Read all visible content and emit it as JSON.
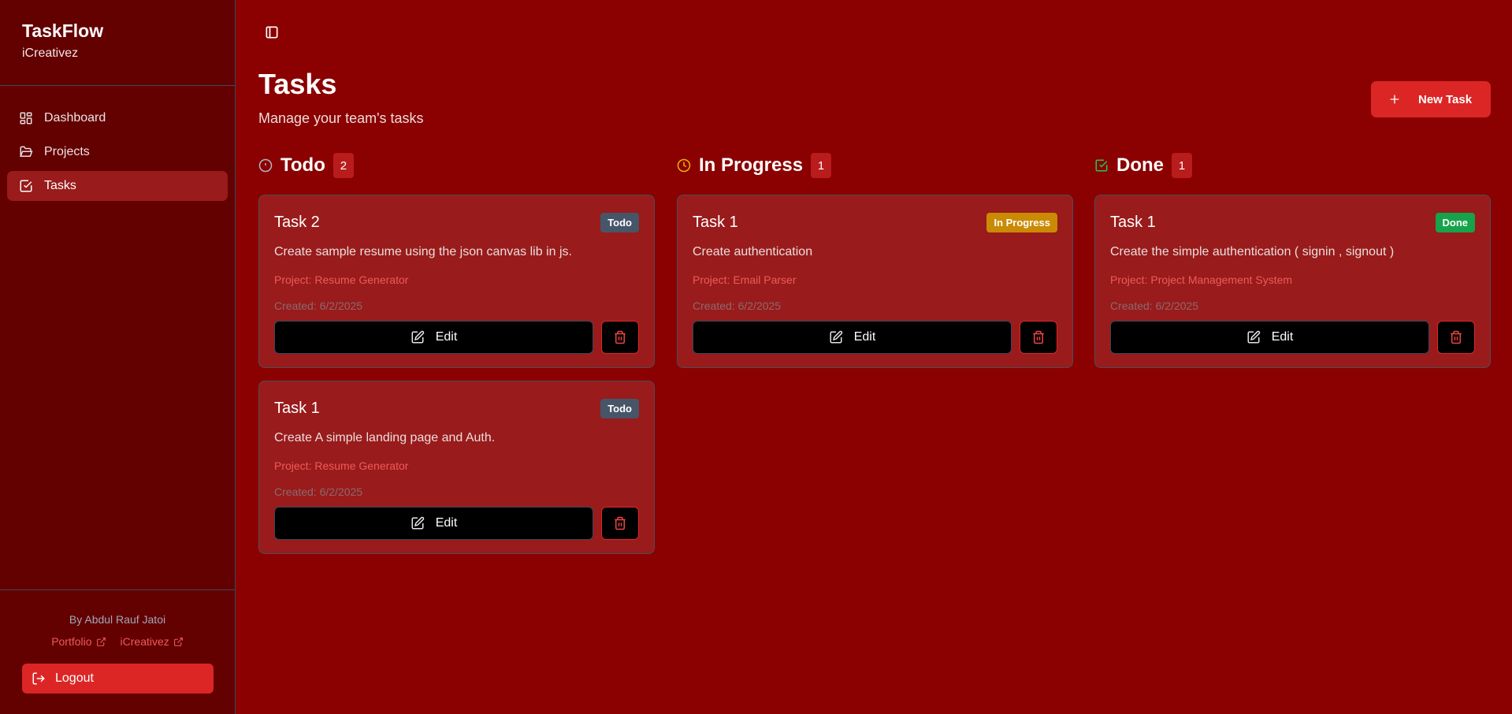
{
  "sidebar": {
    "title": "TaskFlow",
    "subtitle": "iCreativez",
    "items": [
      {
        "label": "Dashboard",
        "icon": "dashboard-icon"
      },
      {
        "label": "Projects",
        "icon": "folder-icon"
      },
      {
        "label": "Tasks",
        "icon": "check-square-icon",
        "active": true
      }
    ],
    "footer": {
      "by": "By Abdul Rauf Jatoi",
      "links": [
        "Portfolio",
        "iCreativez"
      ],
      "logout": "Logout"
    }
  },
  "header": {
    "title": "Tasks",
    "subtitle": "Manage your team's tasks",
    "new_task": "New Task"
  },
  "colors": {
    "accent": "#dc2626",
    "todo": "#475569",
    "in_progress": "#ca8a04",
    "done": "#16a34a"
  },
  "columns": [
    {
      "title": "Todo",
      "count": "2",
      "icon": "alert-circle-icon",
      "cards": [
        {
          "title": "Task 2",
          "status": "Todo",
          "desc": "Create sample resume using the json canvas lib in js.",
          "project": "Project: Resume Generator",
          "created": "Created: 6/2/2025",
          "edit": "Edit"
        },
        {
          "title": "Task 1",
          "status": "Todo",
          "desc": "Create A simple landing page and Auth.",
          "project": "Project: Resume Generator",
          "created": "Created: 6/2/2025",
          "edit": "Edit"
        }
      ]
    },
    {
      "title": "In Progress",
      "count": "1",
      "icon": "clock-icon",
      "cards": [
        {
          "title": "Task 1",
          "status": "In Progress",
          "desc": "Create authentication",
          "project": "Project: Email Parser",
          "created": "Created: 6/2/2025",
          "edit": "Edit"
        }
      ]
    },
    {
      "title": "Done",
      "count": "1",
      "icon": "check-square-icon",
      "cards": [
        {
          "title": "Task 1",
          "status": "Done",
          "desc": "Create the simple authentication ( signin , signout )",
          "project": "Project: Project Management System",
          "created": "Created: 6/2/2025",
          "edit": "Edit"
        }
      ]
    }
  ]
}
